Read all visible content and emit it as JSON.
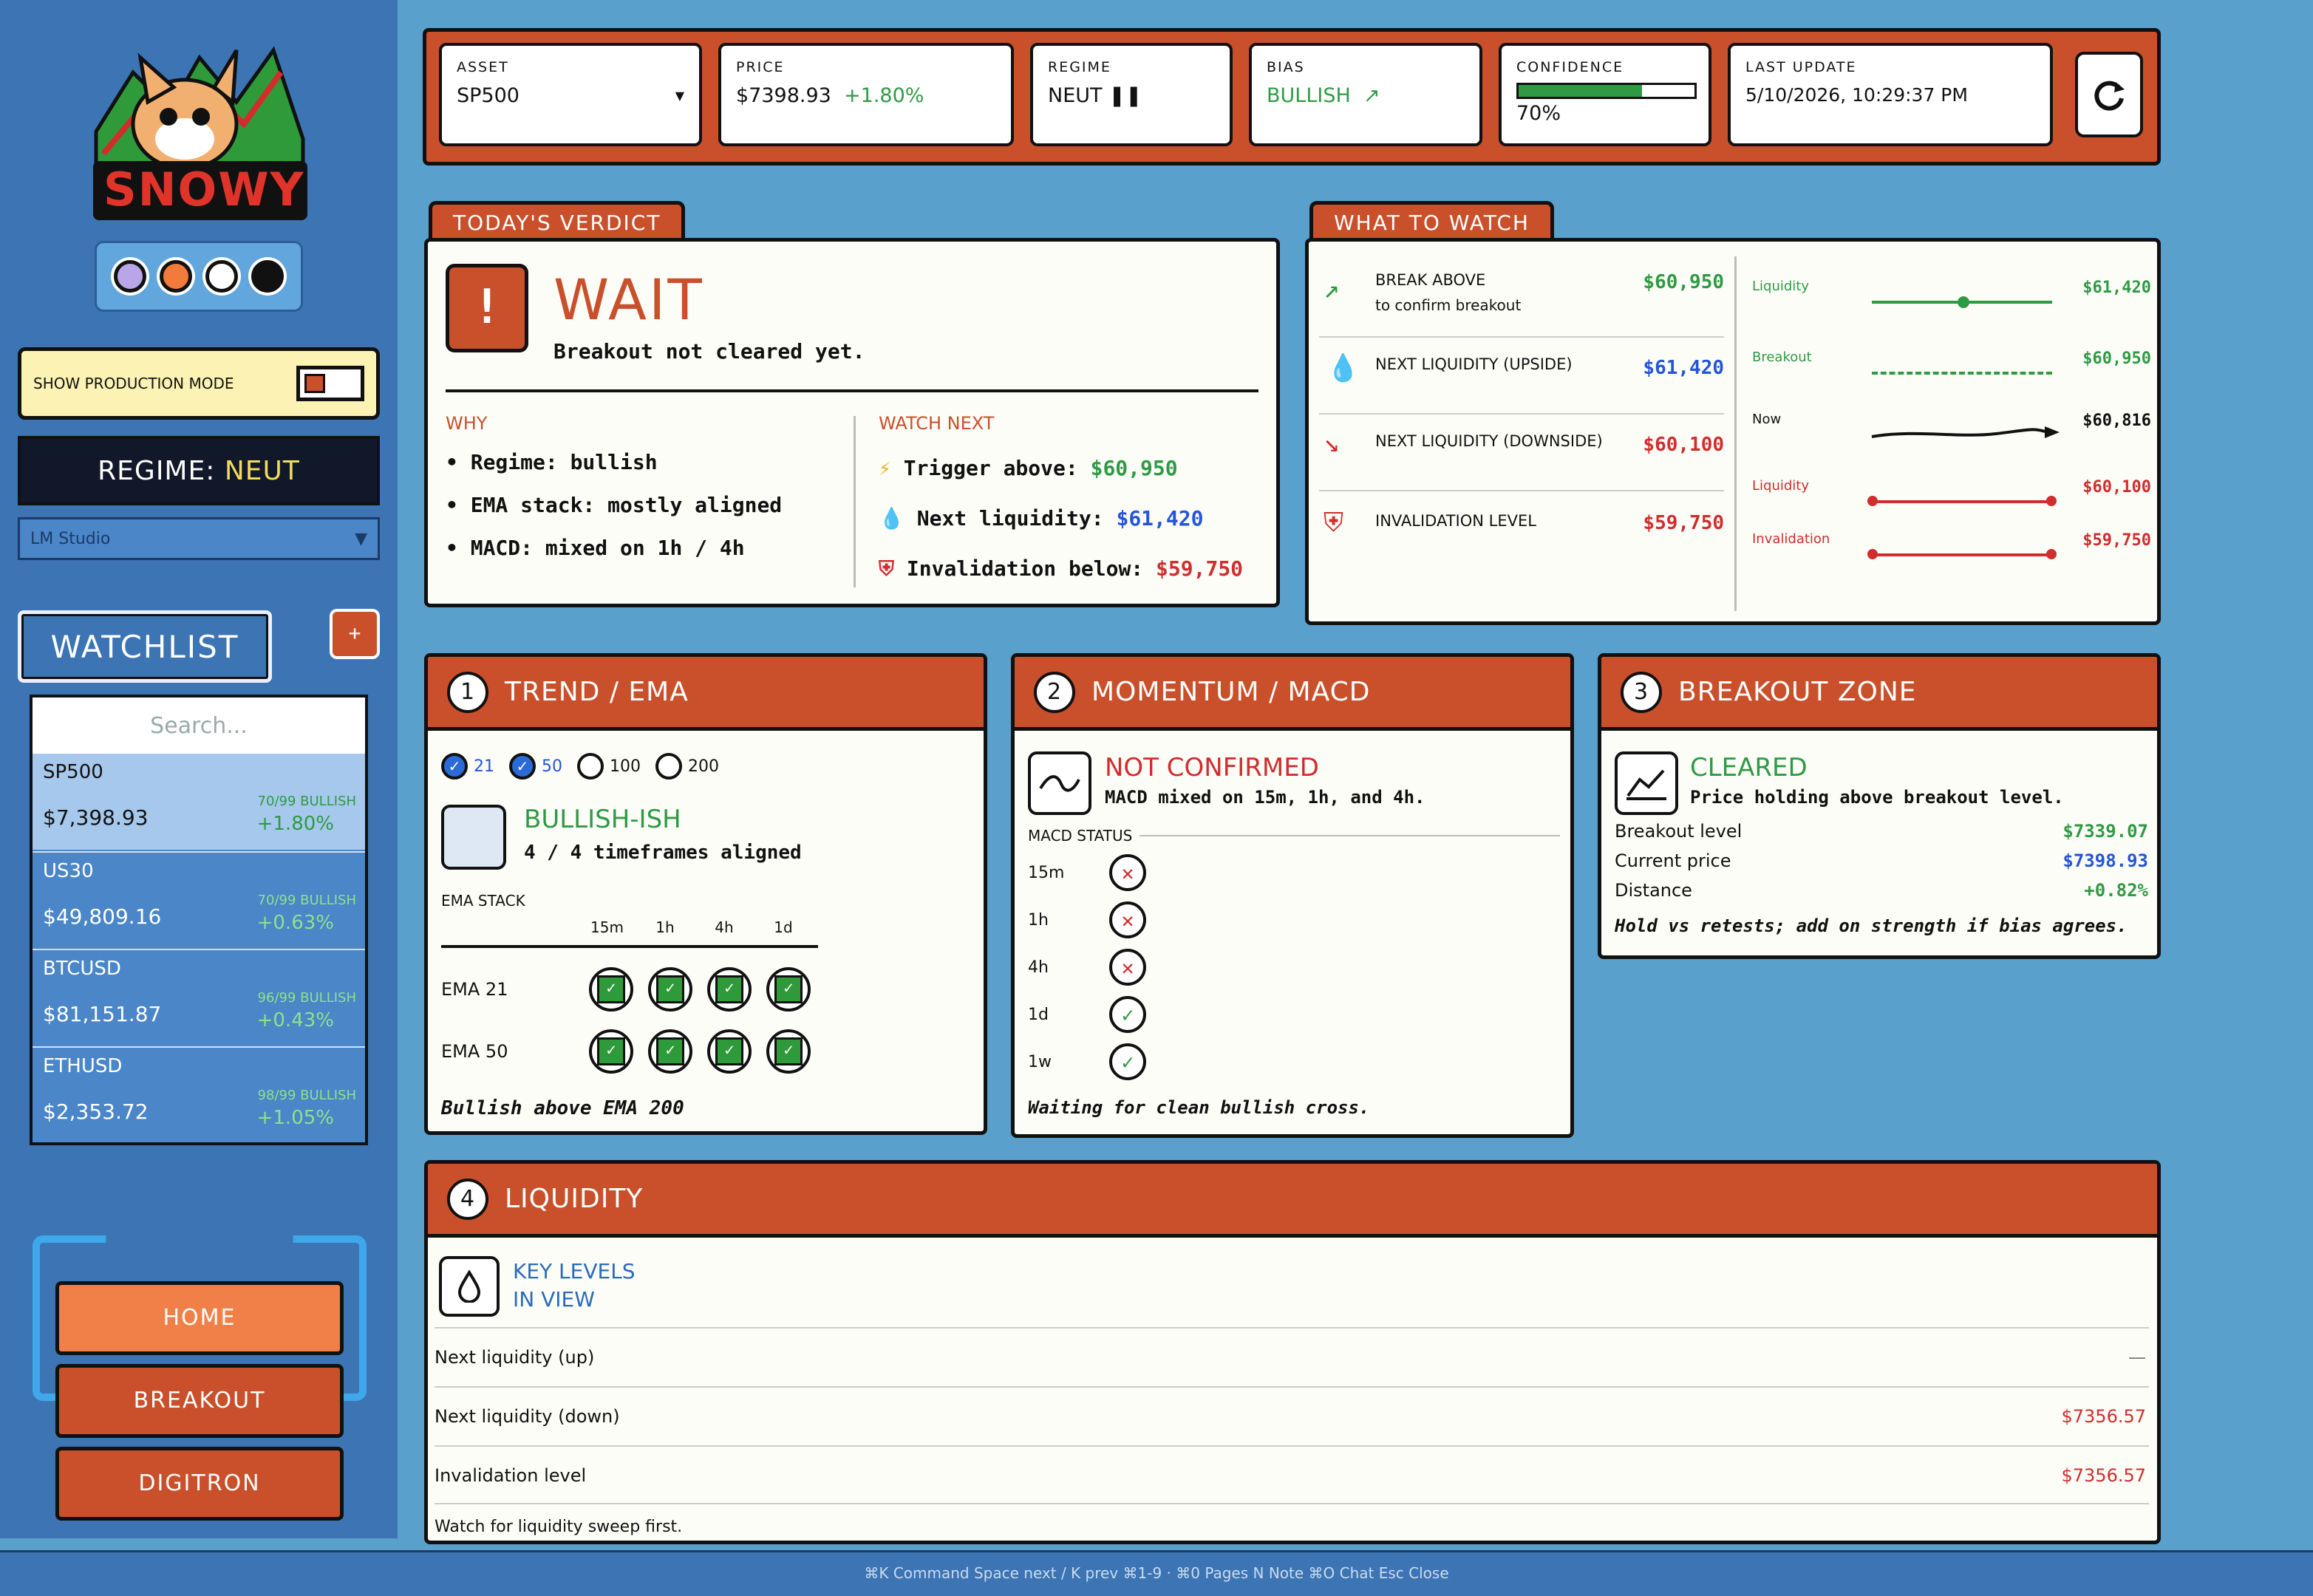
{
  "brand": {
    "name": "SNOWY"
  },
  "sidebar": {
    "production_toggle_label": "SHOW PRODUCTION MODE",
    "regime_label": "REGIME:",
    "regime_value": "NEUT",
    "model_select": "LM Studio",
    "watchlist_title": "WATCHLIST",
    "add_label": "+",
    "search_placeholder": "Search...",
    "watchlist": [
      {
        "symbol": "SP500",
        "price": "$7,398.93",
        "bull": "70/99 BULLISH",
        "change": "+1.80%"
      },
      {
        "symbol": "US30",
        "price": "$49,809.16",
        "bull": "70/99 BULLISH",
        "change": "+0.63%"
      },
      {
        "symbol": "BTCUSD",
        "price": "$81,151.87",
        "bull": "96/99 BULLISH",
        "change": "+0.43%"
      },
      {
        "symbol": "ETHUSD",
        "price": "$2,353.72",
        "bull": "98/99 BULLISH",
        "change": "+1.05%"
      }
    ],
    "nav": {
      "home": "HOME",
      "breakout": "BREAKOUT",
      "digitron": "DIGITRON"
    },
    "theme_colors": [
      "#b9a6e8",
      "#f27a3a",
      "#ffffff",
      "#111111"
    ]
  },
  "topbar": {
    "asset_label": "ASSET",
    "asset_value": "SP500",
    "price_label": "PRICE",
    "price_value": "$7398.93",
    "price_change": "+1.80%",
    "regime_label": "REGIME",
    "regime_value": "NEUT",
    "bias_label": "BIAS",
    "bias_value": "BULLISH",
    "confidence_label": "CONFIDENCE",
    "confidence_value": "70%",
    "confidence_fraction": 0.7,
    "update_label": "LAST UPDATE",
    "update_value": "5/10/2026, 10:29:37 PM"
  },
  "verdict": {
    "tab": "TODAY'S VERDICT",
    "title": "WAIT",
    "subtitle": "Breakout not cleared yet.",
    "why_label": "WHY",
    "why": [
      "Regime: bullish",
      "EMA stack: mostly aligned",
      "MACD: mixed on 1h / 4h"
    ],
    "watch_label": "WATCH NEXT",
    "watch": [
      {
        "label": "Trigger above:",
        "value": "$60,950"
      },
      {
        "label": "Next liquidity:",
        "value": "$61,420"
      },
      {
        "label": "Invalidation below:",
        "value": "$59,750"
      }
    ]
  },
  "what_to_watch": {
    "tab": "WHAT TO WATCH",
    "items": [
      {
        "title": "BREAK ABOVE",
        "sub": "to confirm breakout",
        "value": "$60,950"
      },
      {
        "title": "NEXT LIQUIDITY (UPSIDE)",
        "sub": "",
        "value": "$61,420"
      },
      {
        "title": "NEXT LIQUIDITY (DOWNSIDE)",
        "sub": "",
        "value": "$60,100"
      },
      {
        "title": "INVALIDATION LEVEL",
        "sub": "",
        "value": "$59,750"
      }
    ],
    "ladder": [
      {
        "label": "Liquidity",
        "value": "$61,420"
      },
      {
        "label": "Breakout",
        "value": "$60,950"
      },
      {
        "label": "Now",
        "value": "$60,816"
      },
      {
        "label": "Liquidity",
        "value": "$60,100"
      },
      {
        "label": "Invalidation",
        "value": "$59,750"
      }
    ]
  },
  "trend": {
    "num": "1",
    "title": "TREND / EMA",
    "toggles": [
      "21",
      "50",
      "100",
      "200"
    ],
    "status": "BULLISH-ISH",
    "status_sub": "4 / 4 timeframes aligned",
    "stack_label": "EMA STACK",
    "timeframes": [
      "15m",
      "1h",
      "4h",
      "1d"
    ],
    "rows": [
      "EMA 21",
      "EMA 50"
    ],
    "footer": "Bullish above EMA 200"
  },
  "momentum": {
    "num": "2",
    "title": "MOMENTUM / MACD",
    "status": "NOT CONFIRMED",
    "status_sub": "MACD mixed on 15m, 1h, and 4h.",
    "macd_label": "MACD STATUS",
    "rows": [
      {
        "tf": "15m",
        "ok": false
      },
      {
        "tf": "1h",
        "ok": false
      },
      {
        "tf": "4h",
        "ok": false
      },
      {
        "tf": "1d",
        "ok": true
      },
      {
        "tf": "1w",
        "ok": true
      }
    ],
    "footer": "Waiting for clean bullish cross."
  },
  "breakout": {
    "num": "3",
    "title": "BREAKOUT ZONE",
    "status": "CLEARED",
    "status_sub": "Price holding above breakout level.",
    "rows": [
      {
        "label": "Breakout level",
        "value": "$7339.07"
      },
      {
        "label": "Current price",
        "value": "$7398.93"
      },
      {
        "label": "Distance",
        "value": "+0.82%"
      }
    ],
    "footer": "Hold vs retests; add on strength if bias agrees."
  },
  "liquidity": {
    "num": "4",
    "title": "LIQUIDITY",
    "key_levels_1": "KEY LEVELS",
    "key_levels_2": "IN VIEW",
    "rows": [
      {
        "label": "Next liquidity (up)",
        "value": "—"
      },
      {
        "label": "Next liquidity (down)",
        "value": "$7356.57"
      },
      {
        "label": "Invalidation level",
        "value": "$7356.57"
      }
    ],
    "footer": "Watch for liquidity sweep first."
  },
  "footer": {
    "shortcuts": "⌘K Command   Space next / K prev   ⌘1-9 · ⌘0 Pages   N Note   ⌘O Chat   Esc Close"
  }
}
